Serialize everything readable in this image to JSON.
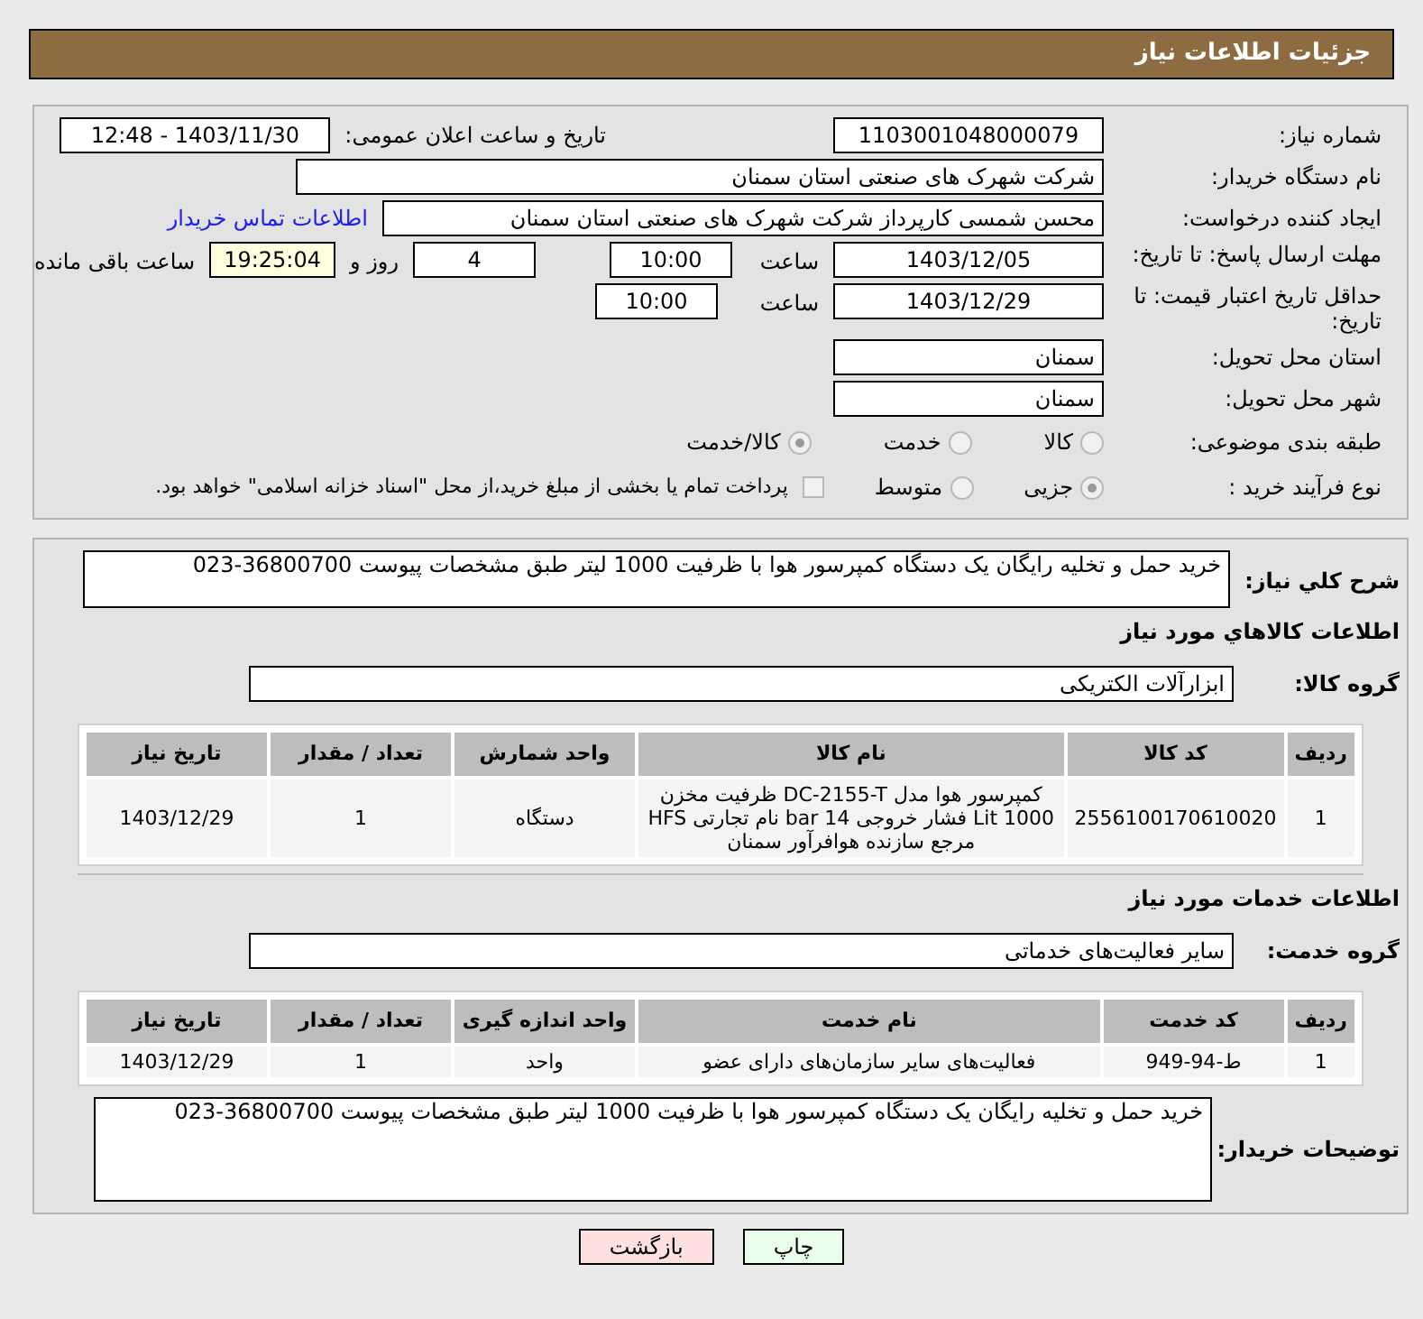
{
  "header": {
    "title": "جزئیات اطلاعات نیاز"
  },
  "need_number": {
    "label": "شماره نیاز:",
    "value": "1103001048000079"
  },
  "announce": {
    "label": "تاریخ و ساعت اعلان عمومی:",
    "value": "1403/11/30 - 12:48"
  },
  "buyer_org": {
    "label": "نام دستگاه خریدار:",
    "value": "شرکت شهرک های صنعتی استان سمنان"
  },
  "requester": {
    "label": "ایجاد کننده درخواست:",
    "value": "محسن شمسی کارپرداز شرکت شهرک های صنعتی استان سمنان",
    "link": "اطلاعات تماس خریدار"
  },
  "reply_deadline": {
    "label": "مهلت ارسال پاسخ: تا تاریخ:",
    "date": "1403/12/05",
    "time_label": "ساعت",
    "time": "10:00",
    "days": "4",
    "days_label": "روز و",
    "remaining": "19:25:04",
    "remaining_label": "ساعت باقی مانده"
  },
  "price_validity": {
    "label": "حداقل تاریخ اعتبار قیمت: تا تاریخ:",
    "date": "1403/12/29",
    "time_label": "ساعت",
    "time": "10:00"
  },
  "province": {
    "label": "استان محل تحویل:",
    "value": "سمنان"
  },
  "city": {
    "label": "شهر محل تحویل:",
    "value": "سمنان"
  },
  "category": {
    "label": "طبقه بندی موضوعی:",
    "options": [
      {
        "label": "کالا",
        "selected": false
      },
      {
        "label": "خدمت",
        "selected": false
      },
      {
        "label": "کالا/خدمت",
        "selected": true
      }
    ]
  },
  "purchase_type": {
    "label": "نوع فرآیند خرید :",
    "options": [
      {
        "label": "جزیی",
        "selected": true
      },
      {
        "label": "متوسط",
        "selected": false
      }
    ],
    "payment": {
      "checked": false,
      "label": "پرداخت تمام یا بخشی از مبلغ خرید،از محل \"اسناد خزانه اسلامی\" خواهد بود."
    }
  },
  "summary": {
    "label": "شرح کلي نياز:",
    "value": "خرید حمل و تخلیه رایگان یک دستگاه کمپرسور هوا با ظرفیت 1000 لیتر طبق مشخصات پیوست 36800700-023"
  },
  "goods": {
    "heading": "اطلاعات کالاهاي مورد نياز",
    "group_label": "گروه کالا:",
    "group": "ابزارآلات الکتریکی",
    "columns": [
      "ردیف",
      "کد کالا",
      "نام کالا",
      "واحد شمارش",
      "تعداد / مقدار",
      "تاریخ نیاز"
    ],
    "rows": [
      [
        "1",
        "2556100170610020",
        "کمپرسور هوا مدل DC-2155-T ظرفیت مخزن Lit 1000 فشار خروجی bar 14 نام تجارتی HFS مرجع سازنده هوافرآور سمنان",
        "دستگاه",
        "1",
        "1403/12/29"
      ]
    ]
  },
  "services": {
    "heading": "اطلاعات خدمات مورد نیاز",
    "group_label": "گروه خدمت:",
    "group": "سایر فعالیت‌های خدماتی",
    "columns": [
      "ردیف",
      "کد خدمت",
      "نام خدمت",
      "واحد اندازه گیری",
      "تعداد / مقدار",
      "تاریخ نیاز"
    ],
    "rows": [
      [
        "1",
        "ط-94-949",
        "فعالیت‌های سایر سازمان‌های دارای عضو",
        "واحد",
        "1",
        "1403/12/29"
      ]
    ]
  },
  "buyer_notes": {
    "label": "توضیحات خریدار:",
    "value": "خرید حمل و تخلیه رایگان یک دستگاه کمپرسور هوا با ظرفیت 1000 لیتر طبق مشخصات پیوست 36800700-023"
  },
  "buttons": [
    {
      "kind": "print",
      "label": "چاپ"
    },
    {
      "kind": "back",
      "label": "بازگشت"
    }
  ]
}
